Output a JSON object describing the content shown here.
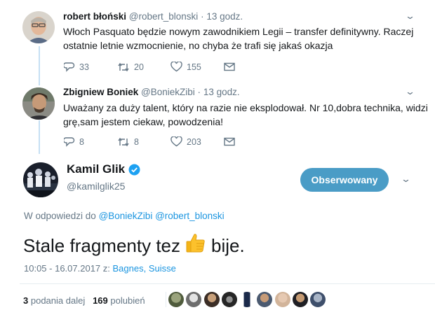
{
  "tweets": [
    {
      "name": "robert błoński",
      "handle": "@robert_blonski",
      "time": "13 godz.",
      "text": "Włoch Pasquato będzie nowym zawodnikiem Legii – transfer definitywny. Raczej ostatnie letnie wzmocnienie, no chyba że trafi się jakaś okazja",
      "replies": "33",
      "retweets": "20",
      "likes": "155"
    },
    {
      "name": "Zbigniew Boniek",
      "handle": "@BoniekZibi",
      "time": "13 godz.",
      "text": "Uważany za duży talent, który na razie nie eksplodował. Nr 10,dobra technika, widzi grę,sam jestem ciekaw, powodzenia!",
      "replies": "8",
      "retweets": "8",
      "likes": "203"
    }
  ],
  "main": {
    "name": "Kamil Glik",
    "handle": "@kamilglik25",
    "follow_label": "Obserwowany",
    "reply_prefix": "W odpowiedzi do",
    "reply_users": [
      "@BoniekZibi",
      "@robert_blonski"
    ],
    "text_before": "Stale fragmenty tez",
    "text_after": "bije.",
    "timestamp": "10:05 - 16.07.2017 z:",
    "location": "Bagnes, Suisse",
    "retweet_count": "3",
    "retweet_label": "podania dalej",
    "like_count": "169",
    "like_label": "polubień"
  },
  "colors": {
    "accent": "#1b95e0",
    "follow_button": "#4a9cc6",
    "thread_line": "#c6e0f4",
    "muted": "#657786",
    "verified": "#1da1f2",
    "thumb": "#fcc12c"
  },
  "icons": [
    "reply-icon",
    "retweet-icon",
    "heart-icon",
    "message-icon",
    "chevron-down-icon",
    "verified-icon",
    "thumbs-up-emoji"
  ]
}
